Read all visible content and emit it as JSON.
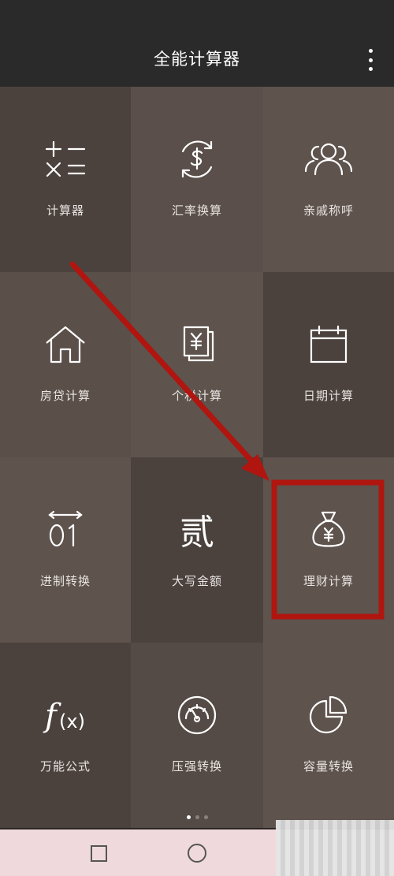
{
  "app": {
    "title": "全能计算器",
    "menu_icon": "more-vertical-icon"
  },
  "tiles": [
    {
      "label": "计算器",
      "icon": "calculator-icon",
      "bg": "#4b423e"
    },
    {
      "label": "汇率换算",
      "icon": "currency-exchange-icon",
      "bg": "#5a4f4a"
    },
    {
      "label": "亲戚称呼",
      "icon": "people-icon",
      "bg": "#5e534d"
    },
    {
      "label": "房贷计算",
      "icon": "house-icon",
      "bg": "#5a4f49"
    },
    {
      "label": "个税计算",
      "icon": "tax-document-icon",
      "bg": "#5e534d"
    },
    {
      "label": "日期计算",
      "icon": "calendar-icon",
      "bg": "#4b423e"
    },
    {
      "label": "进制转换",
      "icon": "binary-icon",
      "bg": "#5e534d"
    },
    {
      "label": "大写金额",
      "icon": "chinese-numeral-icon",
      "bg": "#4b423e"
    },
    {
      "label": "理财计算",
      "icon": "money-bag-icon",
      "bg": "#5e534d"
    },
    {
      "label": "万能公式",
      "icon": "formula-icon",
      "bg": "#4b423e"
    },
    {
      "label": "压强转换",
      "icon": "pressure-gauge-icon",
      "bg": "#554b46"
    },
    {
      "label": "容量转换",
      "icon": "pie-chart-icon",
      "bg": "#5e534d"
    }
  ],
  "pager": {
    "pages": 3,
    "active": 1
  },
  "nav": {
    "recent_icon": "square-icon",
    "home_icon": "circle-icon"
  },
  "annotation": {
    "color": "#b0150f",
    "highlighted_tile": "理财计算"
  }
}
